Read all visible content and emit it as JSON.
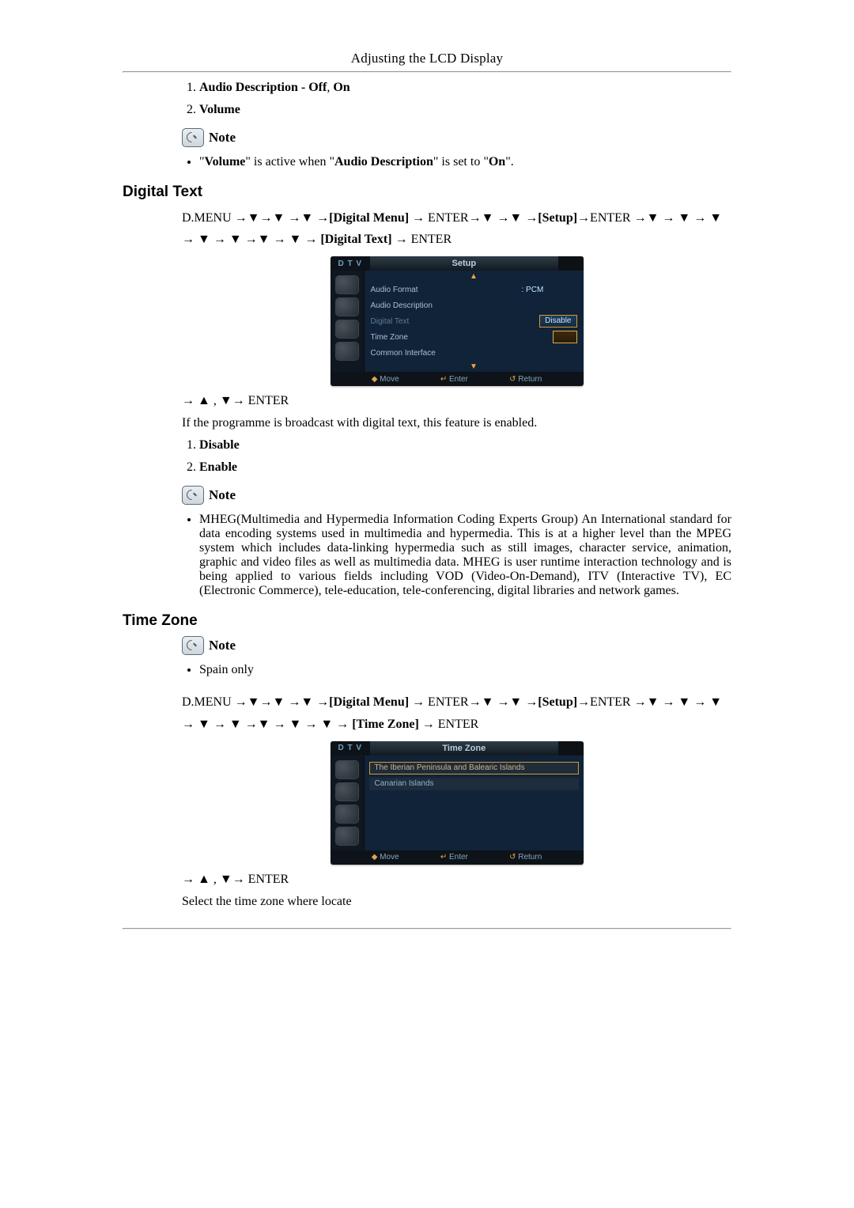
{
  "header": {
    "title": "Adjusting the LCD Display"
  },
  "intro": {
    "list": [
      {
        "prefix": "Audio Description - Off",
        "suffix": "On"
      },
      {
        "single": "Volume"
      }
    ],
    "note_label": "Note",
    "bullet_quote_volume": "Volume",
    "bullet_mid": "\" is active when \"",
    "bullet_quote_ad": "Audio Description",
    "bullet_mid2": "\" is set to \"",
    "bullet_quote_on": "On",
    "bullet_end": "\"."
  },
  "digital_text": {
    "heading": "Digital Text",
    "nav": {
      "p1": "D.MENU →▼→▼ →▼ →",
      "dm": "[Digital Menu]",
      "p2": " → ENTER→▼ →▼ →",
      "setup": "[Setup]",
      "p3": "→ENTER →▼ → ▼ → ▼ → ▼ → ▼ →▼ → ▼ → ",
      "dt": "[Digital Text]",
      "p4": " → ENTER"
    },
    "after_img": "→ ▲ , ▼→ ENTER",
    "body": "If the programme is broadcast with digital text, this feature is enabled.",
    "list": [
      {
        "single": "Disable"
      },
      {
        "single": "Enable"
      }
    ],
    "note_label": "Note",
    "note_body": "MHEG(Multimedia and Hypermedia Information Coding Experts Group) An International standard for data encoding systems used in multimedia and hypermedia. This is at a higher level than the MPEG system which includes data-linking hypermedia such as still images, character service, animation, graphic and video files as well as multimedia data. MHEG is user runtime interaction technology and is being applied to various fields including VOD (Video-On-Demand), ITV (Interactive TV), EC (Electronic Commerce), tele-education, tele-conferencing, digital libraries and network games."
  },
  "osd_setup": {
    "dtv": "D T V",
    "title": "Setup",
    "rows": {
      "audio_format": {
        "lbl": "Audio Format",
        "val": ": PCM"
      },
      "audio_desc": {
        "lbl": "Audio Description"
      },
      "digital_text": {
        "lbl": "Digital Text",
        "sel": "Disable"
      },
      "time_zone": {
        "lbl": "Time Zone"
      },
      "common_if": {
        "lbl": "Common Interface"
      }
    },
    "foot": {
      "move": "Move",
      "enter": "Enter",
      "ret": "Return"
    }
  },
  "time_zone": {
    "heading": "Time Zone",
    "note_label": "Note",
    "bullet": "Spain only",
    "nav": {
      "p1": "D.MENU →▼→▼ →▼ →",
      "dm": "[Digital Menu]",
      "p2": " → ENTER→▼ →▼ →",
      "setup": "[Setup]",
      "p3": "→ENTER →▼ → ▼ → ▼ → ▼ → ▼ →▼ → ▼ → ▼ → ",
      "tz": "[Time Zone]",
      "p4": " → ENTER"
    },
    "after_img": "→ ▲ , ▼→ ENTER",
    "body": "Select the time zone where locate"
  },
  "osd_tz": {
    "dtv": "D T V",
    "title": "Time Zone",
    "row1": "The Iberian Peninsula and Balearic Islands",
    "row2": "Canarian Islands",
    "foot": {
      "move": "Move",
      "enter": "Enter",
      "ret": "Return"
    }
  },
  "symbols": {
    "updown": "◆",
    "enter": "↵",
    "ret": "↺"
  }
}
